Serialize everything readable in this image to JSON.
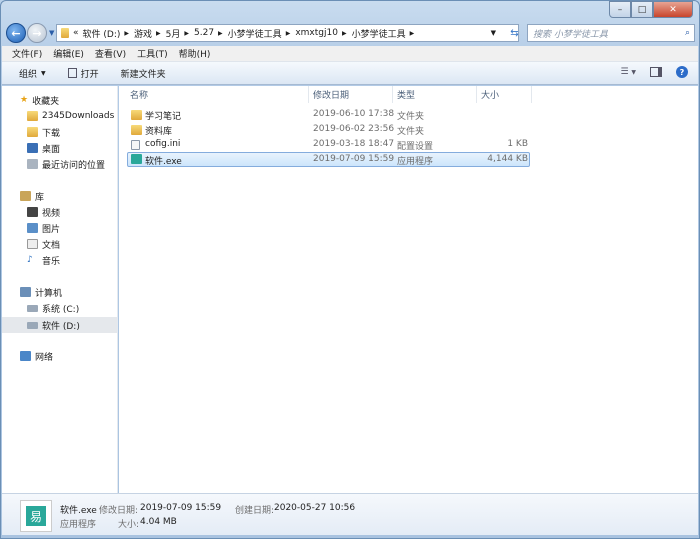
{
  "address": {
    "prefix": "«",
    "segments": [
      "软件 (D:)",
      "游戏",
      "5月",
      "5.27",
      "小梦学徒工具",
      "xmxtgj10",
      "小梦学徒工具"
    ]
  },
  "search": {
    "placeholder": "搜索 小梦学徒工具"
  },
  "menu": [
    "文件(F)",
    "编辑(E)",
    "查看(V)",
    "工具(T)",
    "帮助(H)"
  ],
  "toolbar": {
    "organize": "组织",
    "open": "打开",
    "new_folder": "新建文件夹"
  },
  "sidebar": {
    "favorites": "收藏夹",
    "fav_items": [
      "2345Downloads",
      "下载",
      "桌面",
      "最近访问的位置"
    ],
    "libraries": "库",
    "lib_items": [
      "视频",
      "图片",
      "文档",
      "音乐"
    ],
    "computer": "计算机",
    "comp_items": [
      "系统 (C:)",
      "软件 (D:)"
    ],
    "network": "网络"
  },
  "columns": [
    "名称",
    "修改日期",
    "类型",
    "大小"
  ],
  "files": [
    {
      "name": "学习笔记",
      "date": "2019-06-10 17:38",
      "type": "文件夹",
      "size": ""
    },
    {
      "name": "资料库",
      "date": "2019-06-02 23:56",
      "type": "文件夹",
      "size": ""
    },
    {
      "name": "cofig.ini",
      "date": "2019-03-18 18:47",
      "type": "配置设置",
      "size": "1 KB"
    },
    {
      "name": "软件.exe",
      "date": "2019-07-09 15:59",
      "type": "应用程序",
      "size": "4,144 KB"
    }
  ],
  "status": {
    "name": "软件.exe",
    "modified_label": "修改日期:",
    "modified": "2019-07-09 15:59",
    "created_label": "创建日期:",
    "created": "2020-05-27 10:56",
    "type": "应用程序",
    "size_label": "大小:",
    "size": "4.04 MB"
  }
}
